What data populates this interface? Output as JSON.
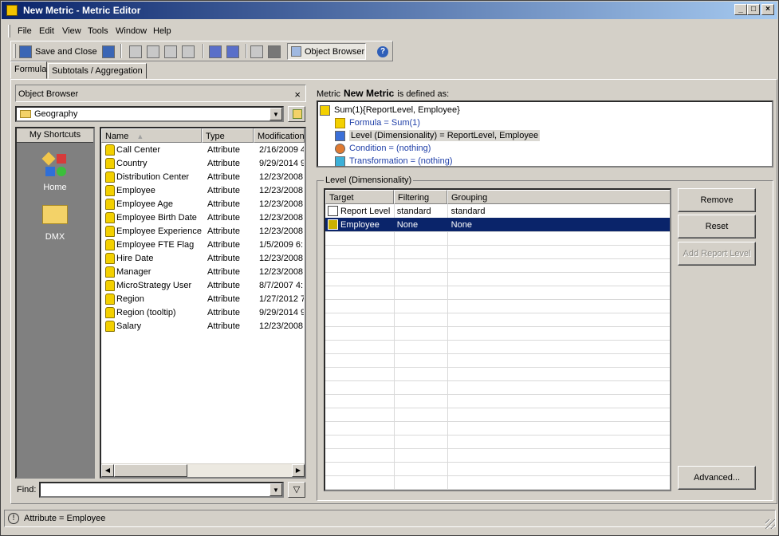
{
  "window": {
    "title": "New Metric - Metric Editor",
    "controls": {
      "minimize": "_",
      "maximize": "□",
      "close": "×"
    }
  },
  "menu": [
    {
      "label": "File",
      "accel": "F"
    },
    {
      "label": "Edit",
      "accel": "E"
    },
    {
      "label": "View",
      "accel": "V"
    },
    {
      "label": "Tools",
      "accel": "T"
    },
    {
      "label": "Window",
      "accel": "W"
    },
    {
      "label": "Help",
      "accel": "H"
    }
  ],
  "toolbar": {
    "save_close_label": "Save and Close",
    "object_browser_label": "Object Browser",
    "icons": [
      "save-close-icon",
      "save-icon",
      "sum-icon",
      "cut-icon",
      "copy-icon",
      "paste-icon",
      "spell-check-icon",
      "spell-check-alt-icon",
      "search-icon",
      "stop-icon",
      "object-browser-icon",
      "help-icon"
    ]
  },
  "tabs": [
    {
      "label": "Formula",
      "active": true
    },
    {
      "label": "Subtotals / Aggregation",
      "active": false
    }
  ],
  "object_browser": {
    "header": "Object Browser",
    "close": "×",
    "folder": "Geography",
    "shortcuts": {
      "header": "My Shortcuts",
      "items": [
        {
          "label": "Home"
        },
        {
          "label": "DMX"
        }
      ]
    },
    "columns": [
      "Name",
      "Type",
      "Modification"
    ],
    "rows": [
      {
        "name": "Call Center",
        "type": "Attribute",
        "modified": "2/16/2009 4"
      },
      {
        "name": "Country",
        "type": "Attribute",
        "modified": "9/29/2014 9"
      },
      {
        "name": "Distribution Center",
        "type": "Attribute",
        "modified": "12/23/2008"
      },
      {
        "name": "Employee",
        "type": "Attribute",
        "modified": "12/23/2008"
      },
      {
        "name": "Employee Age",
        "type": "Attribute",
        "modified": "12/23/2008"
      },
      {
        "name": "Employee Birth Date",
        "type": "Attribute",
        "modified": "12/23/2008"
      },
      {
        "name": "Employee Experience",
        "type": "Attribute",
        "modified": "12/23/2008"
      },
      {
        "name": "Employee FTE Flag",
        "type": "Attribute",
        "modified": "1/5/2009 6:"
      },
      {
        "name": "Hire Date",
        "type": "Attribute",
        "modified": "12/23/2008"
      },
      {
        "name": "Manager",
        "type": "Attribute",
        "modified": "12/23/2008"
      },
      {
        "name": "MicroStrategy User",
        "type": "Attribute",
        "modified": "8/7/2007 4:"
      },
      {
        "name": "Region",
        "type": "Attribute",
        "modified": "1/27/2012 7"
      },
      {
        "name": "Region (tooltip)",
        "type": "Attribute",
        "modified": "9/29/2014 9"
      },
      {
        "name": "Salary",
        "type": "Attribute",
        "modified": "12/23/2008"
      }
    ],
    "find_label": "Find:",
    "find_value": ""
  },
  "definition": {
    "prefix": "Metric",
    "metric_name": "New Metric",
    "suffix": "is defined as:",
    "root": "Sum(1){ReportLevel, Employee}",
    "formula": "Formula = Sum(1)",
    "level": "Level (Dimensionality) = ReportLevel, Employee",
    "condition": "Condition = (nothing)",
    "transformation": "Transformation = (nothing)"
  },
  "level_group": {
    "title": "Level (Dimensionality)",
    "columns": [
      "Target",
      "Filtering",
      "Grouping"
    ],
    "rows": [
      {
        "target": "Report Level",
        "filtering": "standard",
        "grouping": "standard",
        "selected": false
      },
      {
        "target": "Employee",
        "filtering": "None",
        "grouping": "None",
        "selected": true
      }
    ],
    "buttons": {
      "remove": "Remove",
      "reset": "Reset",
      "add_report_level": "Add Report Level",
      "advanced": "Advanced..."
    }
  },
  "status": {
    "text": "Attribute = Employee"
  },
  "colors": {
    "title_bar": "#0a246a",
    "selection": "#0a246a",
    "face": "#d4d0c8",
    "tree_blue": "#1f3fa8"
  }
}
